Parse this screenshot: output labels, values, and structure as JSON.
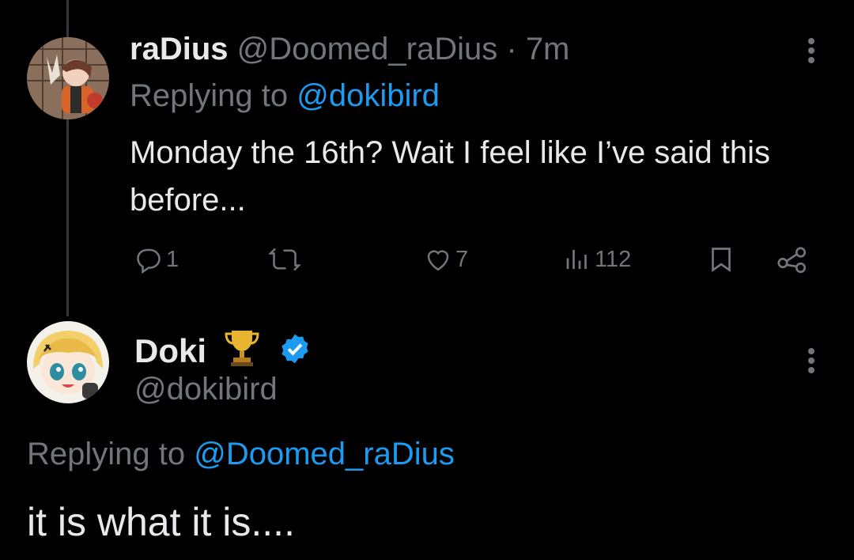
{
  "reply_tweet": {
    "display_name": "raDius",
    "handle": "@Doomed_raDius",
    "separator": " · ",
    "time": "7m",
    "replying_prefix": "Replying to ",
    "replying_to": "@dokibird",
    "text": "Monday the 16th? Wait I feel like I’ve said this before...",
    "actions": {
      "replies": "1",
      "reposts": "",
      "likes": "7",
      "views": "112"
    },
    "avatar_icon": "avatar-radius-icon",
    "more_icon": "more-vertical-icon"
  },
  "main_tweet": {
    "display_name": "Doki",
    "badge_emoji": "trophy-icon",
    "verified_icon": "verified-badge-icon",
    "handle": "@dokibird",
    "replying_prefix": "Replying to ",
    "replying_to": "@Doomed_raDius",
    "text": "it is what it is....",
    "more_icon": "more-vertical-icon"
  },
  "colors": {
    "background": "#000000",
    "text": "#e7e9ea",
    "muted": "#71767b",
    "link": "#1d9bf0",
    "verified": "#1d9bf0",
    "thread_line": "#333639"
  }
}
